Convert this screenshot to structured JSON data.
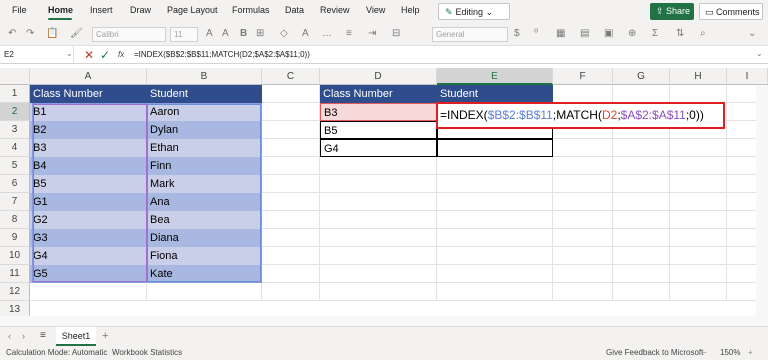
{
  "menu": {
    "tabs": [
      "File",
      "Home",
      "Insert",
      "Draw",
      "Page Layout",
      "Formulas",
      "Data",
      "Review",
      "View",
      "Help"
    ],
    "editing": "Editing",
    "share": "Share",
    "comments": "Comments"
  },
  "toolbar": {
    "font": "Calibri",
    "size": "11",
    "format": "General"
  },
  "formula_bar": {
    "cell_ref": "E2",
    "fx": "fx",
    "formula": "=INDEX($B$2:$B$11;MATCH(D2;$A$2:$A$11;0))"
  },
  "grid": {
    "columns": [
      "A",
      "B",
      "C",
      "D",
      "E",
      "F",
      "G",
      "H",
      "I"
    ],
    "rows": [
      "1",
      "2",
      "3",
      "4",
      "5",
      "6",
      "7",
      "8",
      "9",
      "10",
      "11",
      "12",
      "13"
    ],
    "table1": {
      "headers": [
        "Class Number",
        "Student"
      ],
      "rows": [
        [
          "B1",
          "Aaron"
        ],
        [
          "B2",
          "Dylan"
        ],
        [
          "B3",
          "Ethan"
        ],
        [
          "B4",
          "Finn"
        ],
        [
          "B5",
          "Mark"
        ],
        [
          "G1",
          "Ana"
        ],
        [
          "G2",
          "Bea"
        ],
        [
          "G3",
          "Diana"
        ],
        [
          "G4",
          "Fiona"
        ],
        [
          "G5",
          "Kate"
        ]
      ]
    },
    "table2": {
      "headers": [
        "Class Number",
        "Student"
      ],
      "rows": [
        [
          "B3",
          ""
        ],
        [
          "B5",
          ""
        ],
        [
          "G4",
          ""
        ]
      ]
    },
    "edit_formula": {
      "prefix": "=INDEX(",
      "ref1": "$B$2:$B$11",
      "mid": ";MATCH(",
      "ref2": "D2",
      "sep": ";",
      "ref3": "$A$2:$A$11",
      "suffix": ";0))"
    }
  },
  "sheet": {
    "name": "Sheet1"
  },
  "status": {
    "calc_mode": "Calculation Mode: Automatic",
    "stats": "Workbook Statistics",
    "feedback": "Give Feedback to Microsoft",
    "zoom": "150%"
  }
}
